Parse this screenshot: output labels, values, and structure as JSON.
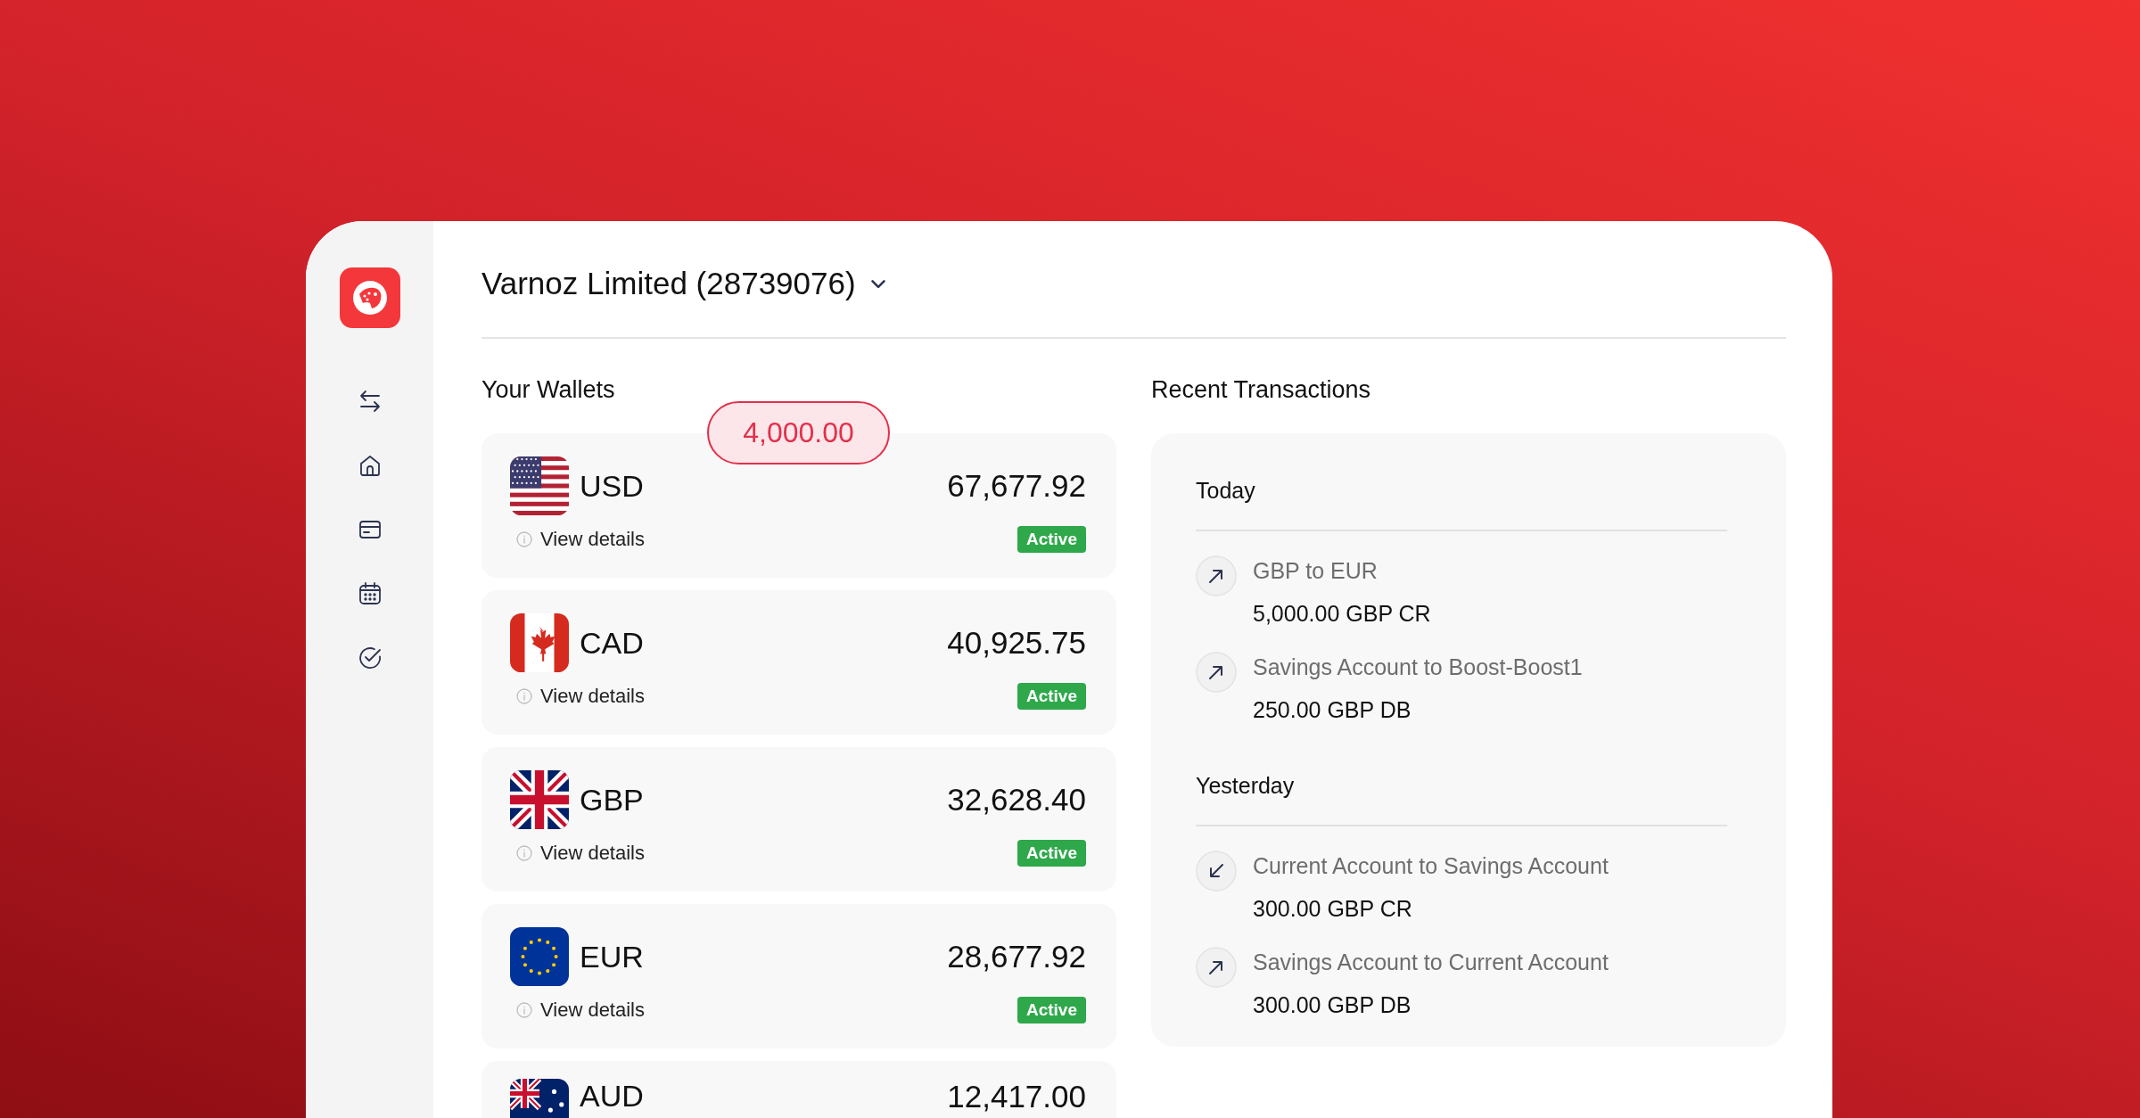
{
  "company": {
    "name": "Varnoz Limited (28739076)"
  },
  "wallets": {
    "title": "Your Wallets",
    "bubble": {
      "amount": "4,000.00"
    },
    "items": [
      {
        "currency": "USD",
        "kind": "us",
        "amount": "67,677.92",
        "link": "View details",
        "status": "Active"
      },
      {
        "currency": "CAD",
        "kind": "ca",
        "amount": "40,925.75",
        "link": "View details",
        "status": "Active"
      },
      {
        "currency": "GBP",
        "kind": "gb",
        "amount": "32,628.40",
        "link": "View details",
        "status": "Active"
      },
      {
        "currency": "EUR",
        "kind": "eu",
        "amount": "28,677.92",
        "link": "View details",
        "status": "Active"
      },
      {
        "currency": "AUD",
        "kind": "au",
        "amount": "12,417.00"
      }
    ]
  },
  "transactions": {
    "title": "Recent Transactions",
    "groups": [
      {
        "label": "Today",
        "items": [
          {
            "kind": "out",
            "description": "GBP to EUR",
            "amount": "5,000.00 GBP CR"
          },
          {
            "kind": "out",
            "description": "Savings Account to Boost-Boost1",
            "amount": "250.00 GBP DB"
          }
        ]
      },
      {
        "label": "Yesterday",
        "items": [
          {
            "kind": "in",
            "description": "Current Account to Savings Account",
            "amount": "300.00 GBP CR"
          },
          {
            "kind": "out",
            "description": "Savings Account to Current Account",
            "amount": "300.00 GBP DB"
          }
        ]
      }
    ]
  }
}
